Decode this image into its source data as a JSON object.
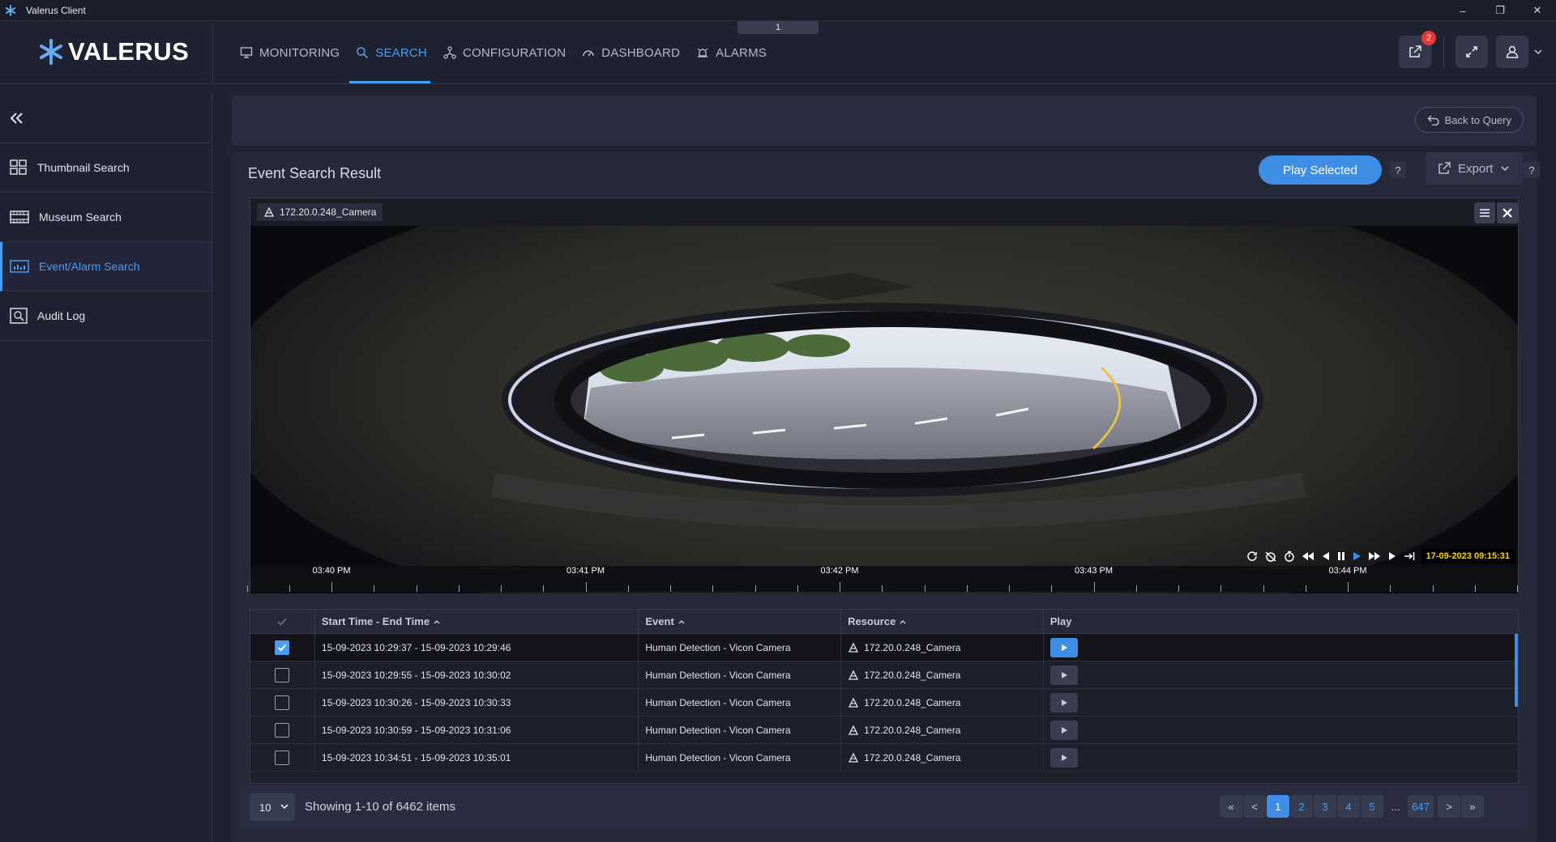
{
  "window": {
    "title": "Valerus Client"
  },
  "header": {
    "brand": "VALERUS",
    "tab_indicator": "1",
    "nav": [
      {
        "label": "MONITORING",
        "icon": "monitor-icon",
        "active": false
      },
      {
        "label": "SEARCH",
        "icon": "search-icon",
        "active": true
      },
      {
        "label": "CONFIGURATION",
        "icon": "configuration-icon",
        "active": false
      },
      {
        "label": "DASHBOARD",
        "icon": "dashboard-icon",
        "active": false
      },
      {
        "label": "ALARMS",
        "icon": "alarm-icon",
        "active": false
      }
    ],
    "notification_count": "2",
    "accent_color": "#4a9df0"
  },
  "sidebar": {
    "items": [
      {
        "label": "Thumbnail Search",
        "icon": "grid-icon",
        "active": false
      },
      {
        "label": "Museum Search",
        "icon": "film-icon",
        "active": false
      },
      {
        "label": "Event/Alarm Search",
        "icon": "chart-icon",
        "active": true
      },
      {
        "label": "Audit Log",
        "icon": "audit-icon",
        "active": false
      }
    ]
  },
  "query": {
    "back_label": "Back to Query"
  },
  "result": {
    "title": "Event Search Result",
    "play_selected_label": "Play Selected",
    "help_label": "?",
    "export_label": "Export"
  },
  "video": {
    "camera_label": "172.20.0.248_Camera",
    "timestamp": "17-09-2023 09:15:31",
    "timeline_labels": [
      "03:40 PM",
      "03:41 PM",
      "03:42 PM",
      "03:43 PM",
      "03:44 PM"
    ]
  },
  "table": {
    "headers": {
      "time": "Start Time - End Time",
      "event": "Event",
      "resource": "Resource",
      "play": "Play"
    },
    "rows": [
      {
        "time": "15-09-2023 10:29:37  - 15-09-2023 10:29:46",
        "event": "Human Detection - Vicon Camera",
        "resource": "172.20.0.248_Camera",
        "checked": true
      },
      {
        "time": "15-09-2023 10:29:55  - 15-09-2023 10:30:02",
        "event": "Human Detection - Vicon Camera",
        "resource": "172.20.0.248_Camera",
        "checked": false
      },
      {
        "time": "15-09-2023 10:30:26  - 15-09-2023 10:30:33",
        "event": "Human Detection - Vicon Camera",
        "resource": "172.20.0.248_Camera",
        "checked": false
      },
      {
        "time": "15-09-2023 10:30:59  - 15-09-2023 10:31:06",
        "event": "Human Detection - Vicon Camera",
        "resource": "172.20.0.248_Camera",
        "checked": false
      },
      {
        "time": "15-09-2023 10:34:51  - 15-09-2023 10:35:01",
        "event": "Human Detection - Vicon Camera",
        "resource": "172.20.0.248_Camera",
        "checked": false
      }
    ]
  },
  "pagination": {
    "page_size": "10",
    "showing": "Showing 1-10 of 6462 items",
    "first": "«",
    "prev": "<",
    "pages": [
      "1",
      "2",
      "3",
      "4",
      "5"
    ],
    "dots": "...",
    "last_page": "647",
    "next": ">",
    "last": "»",
    "current": "1"
  }
}
